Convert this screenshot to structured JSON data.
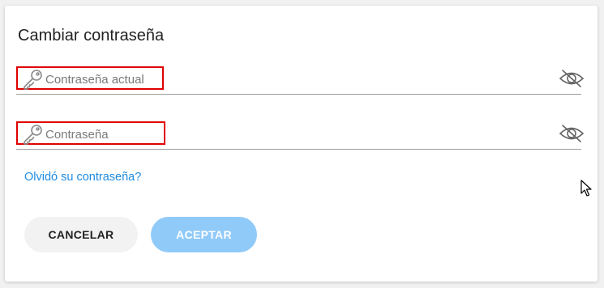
{
  "dialog": {
    "title": "Cambiar contraseña",
    "current_password": {
      "placeholder": "Contraseña actual",
      "value": "",
      "leading_icon": "key-icon",
      "trailing_icon": "eye-off-icon"
    },
    "new_password": {
      "placeholder": "Contraseña",
      "value": "",
      "leading_icon": "key-icon",
      "trailing_icon": "eye-off-icon"
    },
    "forgot_link": "Olvidó su contraseña?",
    "cancel_label": "CANCELAR",
    "accept_label": "ACEPTAR",
    "highlight_color": "#e00000",
    "link_color": "#1d8be0",
    "accept_color": "#90caf9"
  }
}
